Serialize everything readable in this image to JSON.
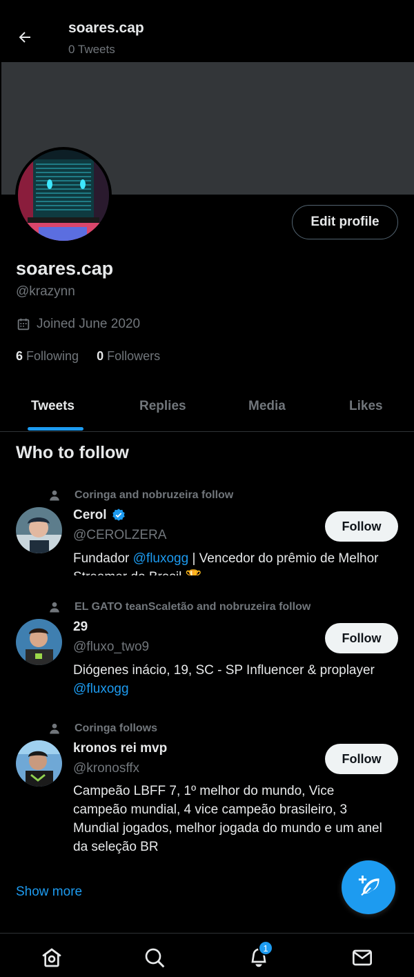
{
  "header": {
    "title": "soares.cap",
    "subtitle": "0 Tweets"
  },
  "profile": {
    "edit_label": "Edit profile",
    "display_name": "soares.cap",
    "handle": "@krazynn",
    "joined": "Joined June 2020",
    "following_count": "6",
    "following_label": "Following",
    "followers_count": "0",
    "followers_label": "Followers"
  },
  "tabs": [
    {
      "label": "Tweets",
      "active": true
    },
    {
      "label": "Replies",
      "active": false
    },
    {
      "label": "Media",
      "active": false
    },
    {
      "label": "Likes",
      "active": false
    }
  ],
  "who_to_follow": {
    "title": "Who to follow",
    "show_more": "Show more",
    "items": [
      {
        "social_context": "Coringa and nobruzeira follow",
        "name": "Cerol",
        "verified": true,
        "handle": "@CEROLZERA",
        "bio_pre": "Fundador ",
        "bio_link": "@fluxogg",
        "bio_post": " | Vencedor do prêmio de Melhor Streamer do Brasil 🏆",
        "follow_label": "Follow"
      },
      {
        "social_context": "EL GATO teanScaletão and nobruzeira follow",
        "name": "29",
        "handle": "@fluxo_two9",
        "bio_pre": "Diógenes inácio, 19, SC - SP Influencer & proplayer",
        "bio_link": "@fluxogg",
        "follow_label": "Follow"
      },
      {
        "social_context": "Coringa follows",
        "name": "kronos rei mvp",
        "handle": "@kronosffx",
        "bio_pre": "Campeão LBFF 7, 1º melhor do mundo, Vice campeão mundial, 4 vice campeão brasileiro, 3 Mundial jogados, melhor jogada do mundo e um anel da seleção BR",
        "follow_label": "Follow"
      }
    ]
  },
  "nav": {
    "items": [
      "home-icon",
      "search-icon",
      "notifications-icon",
      "messages-icon"
    ],
    "notification_badge": "1"
  },
  "colors": {
    "accent": "#1d9bf0",
    "background": "#000000",
    "secondary_text": "#71767b",
    "banner": "#333639"
  }
}
